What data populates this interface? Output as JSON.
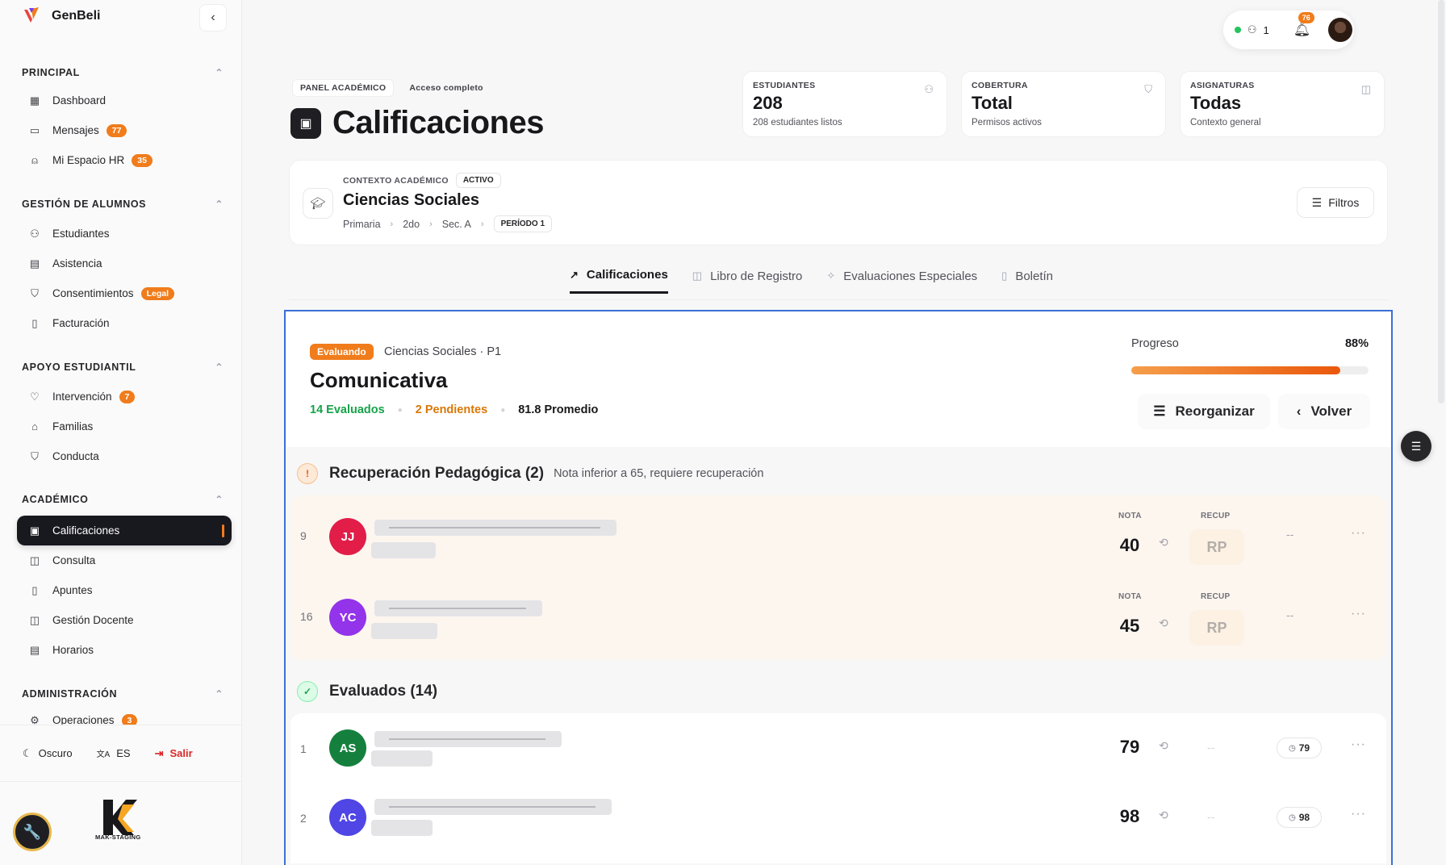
{
  "app": {
    "name": "GenBeli"
  },
  "sidebar": {
    "sections": [
      {
        "title": "PRINCIPAL",
        "items": [
          {
            "label": "Dashboard",
            "icon": "grid-icon"
          },
          {
            "label": "Mensajes",
            "icon": "message-icon",
            "badge": "77"
          },
          {
            "label": "Mi Espacio HR",
            "icon": "user-icon",
            "badge": "35"
          }
        ]
      },
      {
        "title": "GESTIÓN DE ALUMNOS",
        "items": [
          {
            "label": "Estudiantes",
            "icon": "users-icon"
          },
          {
            "label": "Asistencia",
            "icon": "calendar-icon"
          },
          {
            "label": "Consentimientos",
            "icon": "shield-icon",
            "badge": "Legal"
          },
          {
            "label": "Facturación",
            "icon": "file-icon"
          }
        ]
      },
      {
        "title": "APOYO ESTUDIANTIL",
        "items": [
          {
            "label": "Intervención",
            "icon": "heart-icon",
            "badge": "7"
          },
          {
            "label": "Familias",
            "icon": "building-icon"
          },
          {
            "label": "Conducta",
            "icon": "shield-icon"
          }
        ]
      },
      {
        "title": "ACADÉMICO",
        "items": [
          {
            "label": "Calificaciones",
            "icon": "clipboard-icon",
            "active": true
          },
          {
            "label": "Consulta",
            "icon": "book-icon"
          },
          {
            "label": "Apuntes",
            "icon": "file-icon"
          },
          {
            "label": "Gestión Docente",
            "icon": "book-icon"
          },
          {
            "label": "Horarios",
            "icon": "calendar-icon"
          }
        ]
      },
      {
        "title": "ADMINISTRACIÓN",
        "items": [
          {
            "label": "Operaciones",
            "icon": "gear-icon",
            "badge": "3"
          }
        ]
      }
    ],
    "footer": {
      "theme": "Oscuro",
      "lang": "ES",
      "logout": "Salir"
    },
    "bottom_logo_text": "MAK-STAGING"
  },
  "topbar": {
    "online_count": "1",
    "notif_badge": "76"
  },
  "header": {
    "tag1": "PANEL ACADÉMICO",
    "tag2": "Acceso completo",
    "title": "Calificaciones"
  },
  "stats": [
    {
      "label": "ESTUDIANTES",
      "value": "208",
      "sub": "208 estudiantes listos",
      "icon": "users-icon"
    },
    {
      "label": "COBERTURA",
      "value": "Total",
      "sub": "Permisos activos",
      "icon": "shield-icon"
    },
    {
      "label": "ASIGNATURAS",
      "value": "Todas",
      "sub": "Contexto general",
      "icon": "book-icon"
    }
  ],
  "context": {
    "label": "CONTEXTO ACADÉMICO",
    "status": "ACTIVO",
    "title": "Ciencias Sociales",
    "crumbs": [
      "Primaria",
      "2do",
      "Sec. A"
    ],
    "period": "PERÍODO 1",
    "filters_label": "Filtros"
  },
  "tabs": [
    {
      "label": "Calificaciones",
      "icon": "trend-icon",
      "active": true
    },
    {
      "label": "Libro de Registro",
      "icon": "book-icon"
    },
    {
      "label": "Evaluaciones Especiales",
      "icon": "sparkle-icon"
    },
    {
      "label": "Boletín",
      "icon": "file-icon"
    }
  ],
  "evaluation": {
    "status": "Evaluando",
    "context": "Ciencias Sociales · P1",
    "title": "Comunicativa",
    "evaluated": "14 Evaluados",
    "pending": "2 Pendientes",
    "average": "81.8 Promedio",
    "progress_label": "Progreso",
    "progress_text": "88%",
    "progress": 0.88,
    "reorganize": "Reorganizar",
    "back": "Volver"
  },
  "recovery": {
    "title": "Recuperación Pedagógica (2)",
    "note": "Nota inferior a 65, requiere recuperación",
    "col_nota": "NOTA",
    "col_recup": "RECUP",
    "rows": [
      {
        "num": "9",
        "initials": "JJ",
        "color": "#e11d48",
        "nota": "40",
        "recup": "RP",
        "dash": "--"
      },
      {
        "num": "16",
        "initials": "YC",
        "color": "#9333ea",
        "nota": "45",
        "recup": "RP",
        "dash": "--"
      }
    ]
  },
  "evaluated": {
    "title": "Evaluados (14)",
    "rows": [
      {
        "num": "1",
        "initials": "AS",
        "color": "#15803d",
        "nota": "79",
        "recup": "--",
        "pill": "79"
      },
      {
        "num": "2",
        "initials": "AC",
        "color": "#4f46e5",
        "nota": "98",
        "recup": "--",
        "pill": "98"
      }
    ]
  },
  "more_label": "···"
}
